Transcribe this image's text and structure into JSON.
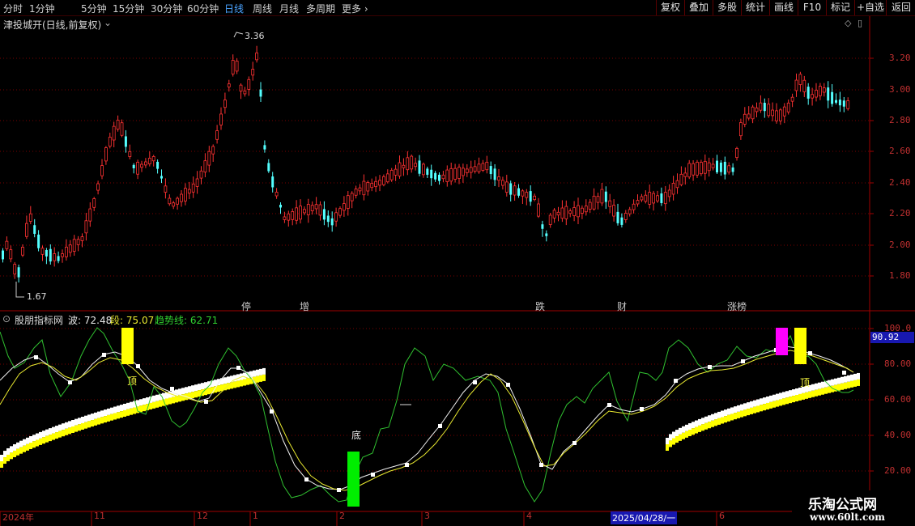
{
  "timeframes": [
    "分时",
    "1分钟",
    "5分钟",
    "15分钟",
    "30分钟",
    "60分钟",
    "日线",
    "周线",
    "月线",
    "多周期",
    "更多"
  ],
  "timeframe_active": "日线",
  "right_buttons": [
    "复权",
    "叠加",
    "多股",
    "统计",
    "画线",
    "F10",
    "标记",
    "+自选",
    "返回"
  ],
  "chart_title": "津投城开(日线,前复权)",
  "high_label": "3.36",
  "low_label": "1.67",
  "y_axis": [
    "3.20",
    "3.00",
    "2.80",
    "2.60",
    "2.40",
    "2.20",
    "2.00",
    "1.80"
  ],
  "events": [
    {
      "text": "停",
      "color": "#40c8ff"
    },
    {
      "text": "增",
      "color": "#ff6060"
    },
    {
      "text": "跌",
      "color": "#40e040"
    },
    {
      "text": "财",
      "color": "#60b0ff"
    },
    {
      "text": "涨榜",
      "color": "#ff6060"
    }
  ],
  "indicator": {
    "name": "股朋指标网",
    "wave_label": "波: 72.48",
    "segment_label": "段: 75.07",
    "trend_label": "趋势线: 62.71",
    "current_value": "90.92",
    "y_axis": [
      "100.0",
      "80.00",
      "60.00",
      "40.00",
      "20.00"
    ],
    "top_label": "顶",
    "bottom_label": "底"
  },
  "x_axis": [
    "2024年",
    "11",
    "12",
    "1",
    "2",
    "3",
    "4",
    "2025/04/28/一",
    "6"
  ],
  "watermark": {
    "title": "乐淘公式网",
    "url": "www.60lt.com"
  },
  "colors": {
    "up": "#ff3232",
    "down": "#54ffff",
    "bg": "#000000",
    "grid": "#a00000",
    "active": "#4aa3ff"
  }
}
